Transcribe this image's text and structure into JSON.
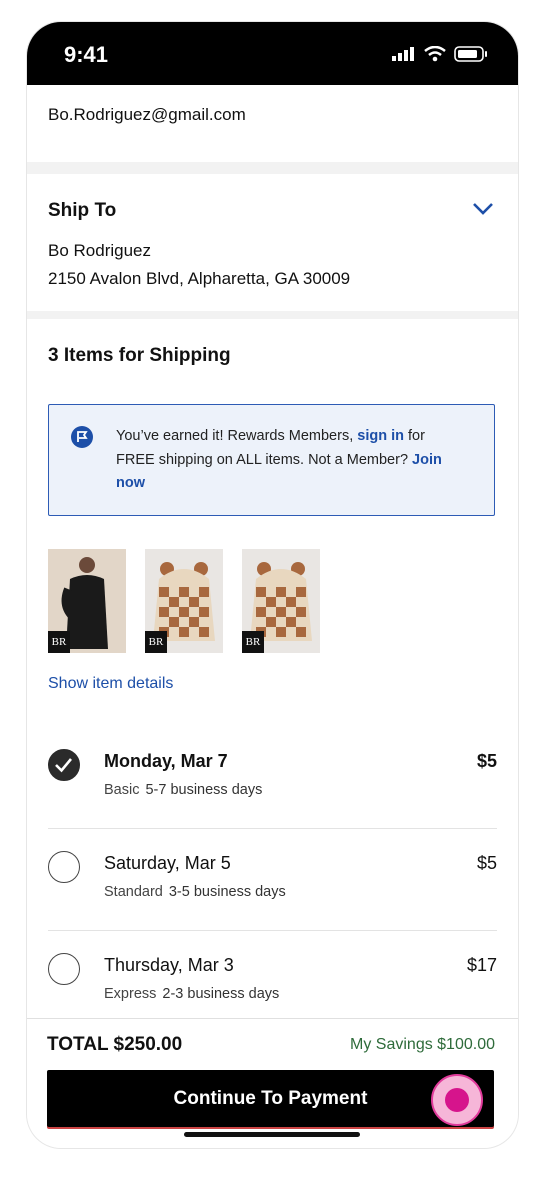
{
  "status": {
    "time": "9:41"
  },
  "account": {
    "email": "Bo.Rodriguez@gmail.com"
  },
  "ship_to": {
    "title": "Ship To",
    "name": "Bo Rodriguez",
    "address": "2150 Avalon Blvd, Alpharetta, GA 30009"
  },
  "items": {
    "title": "3 Items for Shipping",
    "promo": {
      "pre": "You’ve earned it! Rewards Members, ",
      "sign_in": "sign in",
      "mid": " for FREE shipping on ALL items. Not a Member? ",
      "join": "Join now"
    },
    "thumb_badge": "BR",
    "show_details": "Show item details",
    "options": [
      {
        "day": "Monday, Mar 7",
        "tier": "Basic",
        "days": "5-7 business days",
        "price": "$5",
        "selected": true
      },
      {
        "day": "Saturday, Mar 5",
        "tier": "Standard",
        "days": "3-5 business days",
        "price": "$5",
        "selected": false
      },
      {
        "day": "Thursday, Mar 3",
        "tier": "Express",
        "days": "2-3 business days",
        "price": "$17",
        "selected": false
      }
    ]
  },
  "footer": {
    "total": "TOTAL $250.00",
    "savings": "My Savings $100.00",
    "cta": "Continue To Payment"
  },
  "colors": {
    "link": "#1d4fa8",
    "savings": "#2e6b3a",
    "touch": "#d6148c"
  }
}
